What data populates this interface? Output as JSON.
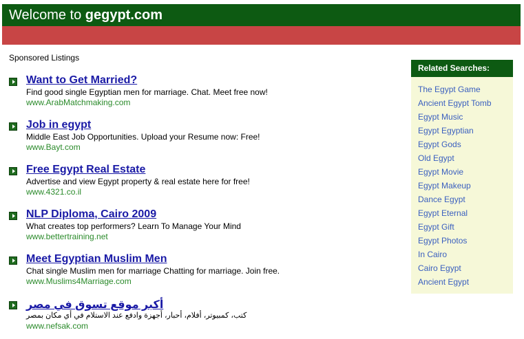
{
  "header": {
    "welcome_text": "Welcome to ",
    "site_name": "gegypt.com"
  },
  "sponsored": {
    "label": "Sponsored Listings",
    "listings": [
      {
        "title": "Want to Get Married?",
        "description": "Find good single Egyptian men for marriage. Chat. Meet free now!",
        "url": "www.ArabMatchmaking.com"
      },
      {
        "title": "Job in egypt",
        "description": "Middle East Job Opportunities. Upload your Resume now: Free!",
        "url": "www.Bayt.com"
      },
      {
        "title": "Free Egypt Real Estate",
        "description": "Advertise and view Egypt property & real estate here for free!",
        "url": "www.4321.co.il"
      },
      {
        "title": "NLP Diploma, Cairo 2009",
        "description": "What creates top performers? Learn To Manage Your Mind",
        "url": "www.bettertraining.net"
      },
      {
        "title": "Meet Egyptian Muslim Men",
        "description": "Chat single Muslim men for marriage Chatting for marriage. Join free.",
        "url": "www.Muslims4Marriage.com"
      },
      {
        "title": "أكبر موقع تسوق في مصر",
        "description": "كتب، كمبيوتر، أفلام، أحبار، أجهزة وادفع عند الاستلام في أي مكان بمصر",
        "url": "www.nefsak.com"
      }
    ]
  },
  "related": {
    "header": "Related Searches:",
    "items": [
      "The Egypt Game",
      "Ancient Egypt Tomb",
      "Egypt Music",
      "Egypt Egyptian",
      "Egypt Gods",
      "Old Egypt",
      "Egypt Movie",
      "Egypt Makeup",
      "Dance Egypt",
      "Egypt Eternal",
      "Egypt Gift",
      "Egypt Photos",
      "In Cairo",
      "Cairo Egypt",
      "Ancient Egypt"
    ]
  },
  "colors": {
    "header_green": "#0d5a12",
    "header_red": "#c84545",
    "title_link": "#1a1aa6",
    "url_green": "#2a8a2a",
    "related_link": "#3a5fbf",
    "sidebar_bg": "#f6f8d8"
  }
}
